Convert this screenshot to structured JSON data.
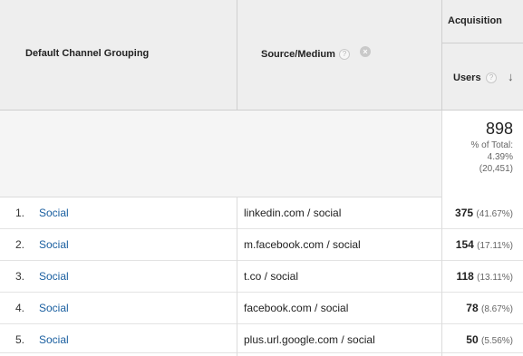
{
  "header": {
    "channel_col": "Default Channel Grouping",
    "source_col": "Source/Medium",
    "group_label": "Acquisition",
    "users_col": "Users",
    "help_glyph": "?",
    "remove_glyph": "×",
    "sort_glyph": "↓"
  },
  "summary": {
    "total": "898",
    "pct_label": "% of Total:",
    "pct_value": "4.39%",
    "site_total": "(20,451)"
  },
  "rows": [
    {
      "num": "1.",
      "channel": "Social",
      "source": "linkedin.com / social",
      "users": "375",
      "pct": "(41.67%)"
    },
    {
      "num": "2.",
      "channel": "Social",
      "source": "m.facebook.com / social",
      "users": "154",
      "pct": "(17.11%)"
    },
    {
      "num": "3.",
      "channel": "Social",
      "source": "t.co / social",
      "users": "118",
      "pct": "(13.11%)"
    },
    {
      "num": "4.",
      "channel": "Social",
      "source": "facebook.com / social",
      "users": "78",
      "pct": "(8.67%)"
    },
    {
      "num": "5.",
      "channel": "Social",
      "source": "plus.url.google.com / social",
      "users": "50",
      "pct": "(5.56%)"
    }
  ]
}
